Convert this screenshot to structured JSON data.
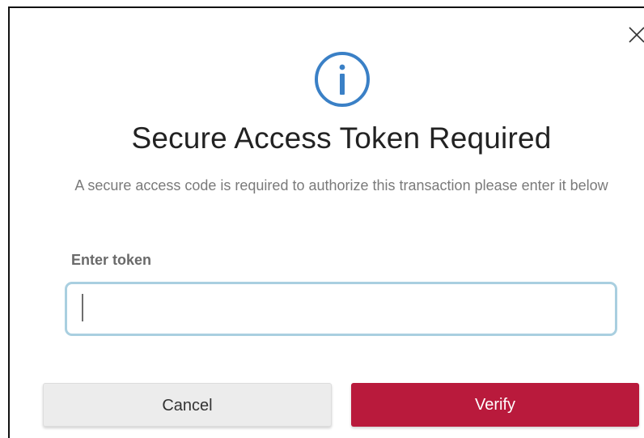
{
  "dialog": {
    "title": "Secure Access Token Required",
    "message": "A secure access code is required to authorize this transaction please enter it below",
    "field_label": "Enter token",
    "token_value": "",
    "cancel_label": "Cancel",
    "verify_label": "Verify"
  },
  "icons": {
    "info": "info-icon",
    "close": "close-icon"
  },
  "colors": {
    "accent": "#b91a3c",
    "info_blue": "#3a80c6",
    "input_border": "#a9cfe0"
  }
}
